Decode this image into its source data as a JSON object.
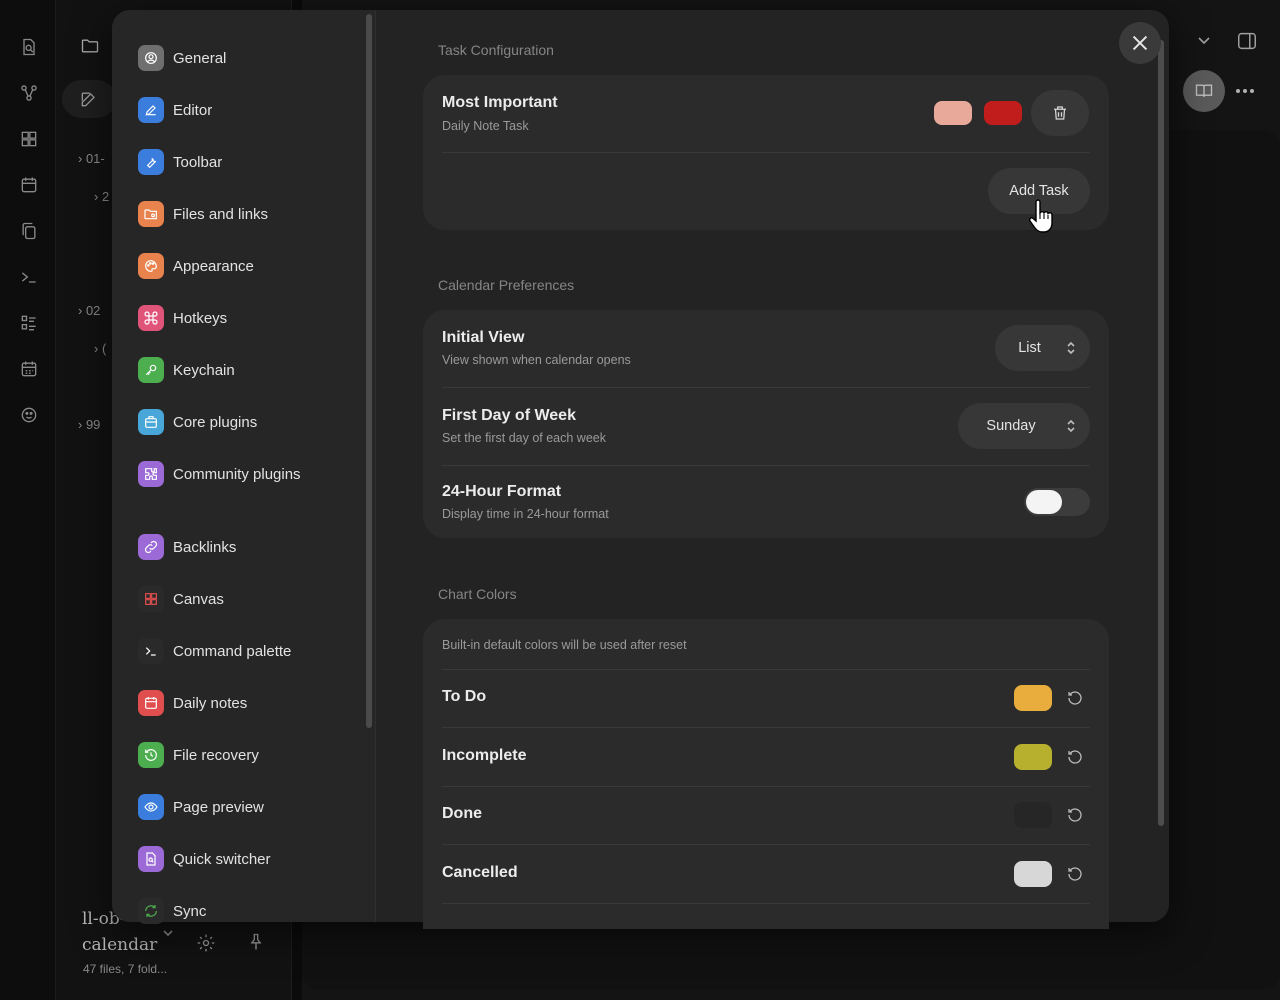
{
  "file_pane": {
    "tree": [
      {
        "text": "01-"
      },
      {
        "text": "2"
      },
      {
        "text": "02"
      },
      {
        "text": "("
      },
      {
        "text": "99"
      }
    ],
    "vault_name": "ll-ob-calendar",
    "vault_meta": "47 files, 7 fold..."
  },
  "settings_nav": {
    "items": [
      {
        "label": "General",
        "icon": "user-circle-icon",
        "color": "#6f6f6f"
      },
      {
        "label": "Editor",
        "icon": "pen-icon",
        "color": "#3b7ddd"
      },
      {
        "label": "Toolbar",
        "icon": "wrench-icon",
        "color": "#3b7ddd"
      },
      {
        "label": "Files and links",
        "icon": "folder-cog-icon",
        "color": "#e8834e"
      },
      {
        "label": "Appearance",
        "icon": "palette-icon",
        "color": "#e8834e"
      },
      {
        "label": "Hotkeys",
        "icon": "command-icon",
        "color": "#e0547a"
      },
      {
        "label": "Keychain",
        "icon": "key-icon",
        "color": "#4cae4f"
      },
      {
        "label": "Core plugins",
        "icon": "plugin-box-icon",
        "color": "#48a7d8"
      },
      {
        "label": "Community plugins",
        "icon": "puzzle-icon",
        "color": "#9b6ad6"
      },
      {
        "label": "Backlinks",
        "icon": "link-icon",
        "color": "#9b6ad6"
      },
      {
        "label": "Canvas",
        "icon": "layout-grid-icon",
        "color": "#2a2a2a"
      },
      {
        "label": "Command palette",
        "icon": "terminal-icon",
        "color": "#2a2a2a"
      },
      {
        "label": "Daily notes",
        "icon": "calendar-icon",
        "color": "#e04e4e"
      },
      {
        "label": "File recovery",
        "icon": "history-icon",
        "color": "#4cae4f"
      },
      {
        "label": "Page preview",
        "icon": "eye-icon",
        "color": "#3b7ddd"
      },
      {
        "label": "Quick switcher",
        "icon": "file-search-icon",
        "color": "#9b6ad6"
      },
      {
        "label": "Sync",
        "icon": "refresh-icon",
        "color": "#2a2a2a"
      }
    ]
  },
  "task_config": {
    "section_title": "Task Configuration",
    "task_title": "Most Important",
    "task_desc": "Daily Note Task",
    "color_a": "#e8a99b",
    "color_b": "#c21d1d",
    "add_task_label": "Add Task"
  },
  "calendar_prefs": {
    "section_title": "Calendar Preferences",
    "initial_view_title": "Initial View",
    "initial_view_desc": "View shown when calendar opens",
    "initial_view_value": "List",
    "first_day_title": "First Day of Week",
    "first_day_desc": "Set the first day of each week",
    "first_day_value": "Sunday",
    "hour_format_title": "24-Hour Format",
    "hour_format_desc": "Display time in 24-hour format",
    "hour_format_enabled": false
  },
  "chart_colors": {
    "section_title": "Chart Colors",
    "note": "Built-in default colors will be used after reset",
    "items": [
      {
        "label": "To Do",
        "color": "#e8ad3c"
      },
      {
        "label": "Incomplete",
        "color": "#b7b02f"
      },
      {
        "label": "Done",
        "color": "#262626"
      },
      {
        "label": "Cancelled",
        "color": "#d7d7d7"
      }
    ]
  }
}
